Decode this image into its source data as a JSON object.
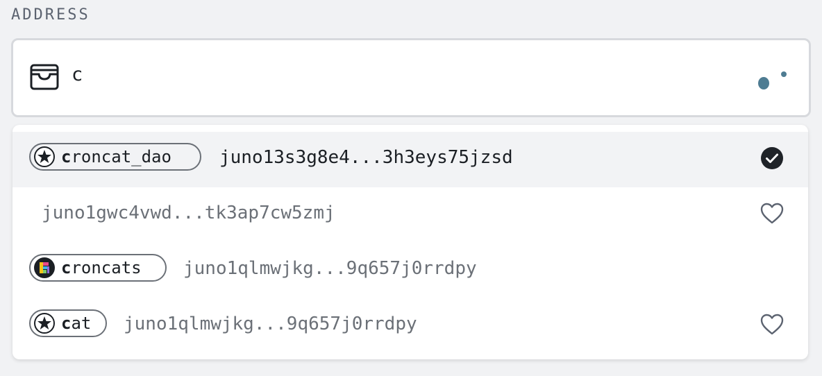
{
  "field": {
    "label": "ADDRESS",
    "value": "c",
    "icons": {
      "left": "wallet-icon",
      "right": "loading-spinner-icon"
    }
  },
  "suggestions": [
    {
      "name_match": "c",
      "name_rest": "roncat_dao",
      "address": "juno13s3g8e4...3h3eys75jzsd",
      "avatar": "star-icon",
      "action": "check-circle-icon",
      "selected": true
    },
    {
      "name_match": "",
      "name_rest": "",
      "address": "juno1gwc4vwd...tk3ap7cw5zmj",
      "avatar": "",
      "action": "heart-icon",
      "selected": false
    },
    {
      "name_match": "c",
      "name_rest": "roncats",
      "address": "juno1qlmwjkg...9q657j0rrdpy",
      "avatar": "croncats-logo-icon",
      "action": "",
      "selected": false
    },
    {
      "name_match": "c",
      "name_rest": "at",
      "address": "juno1qlmwjkg...9q657j0rrdpy",
      "avatar": "star-icon",
      "action": "heart-icon",
      "selected": false
    }
  ],
  "colors": {
    "selected_bg": "#f2f3f5",
    "spinner": "#4e7c92",
    "muted_text": "#6b7077"
  }
}
